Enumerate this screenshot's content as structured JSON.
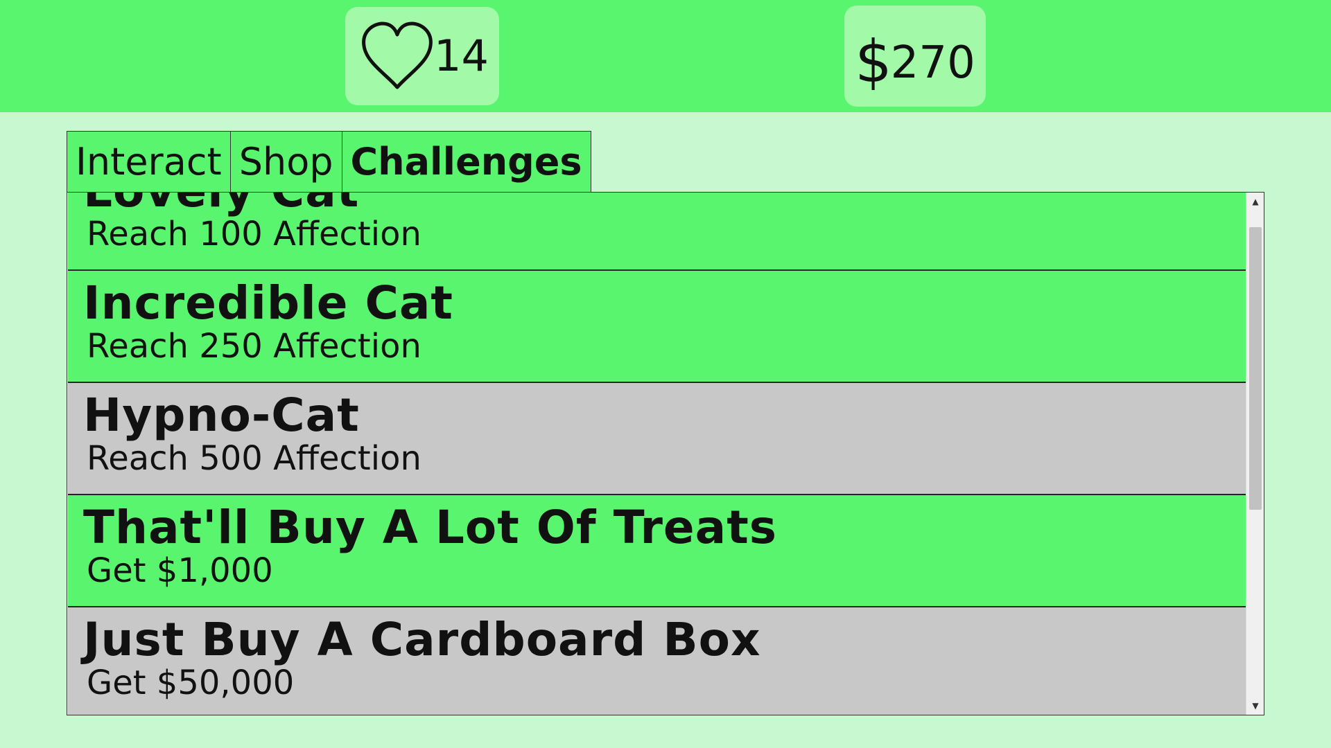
{
  "stats": {
    "affection": "14",
    "money": "270",
    "currency_symbol": "$"
  },
  "tabs": [
    {
      "label": "Interact",
      "active": false
    },
    {
      "label": "Shop",
      "active": false
    },
    {
      "label": "Challenges",
      "active": true
    }
  ],
  "challenges": [
    {
      "title": "Lovely Cat",
      "description": "Reach 100 Affection",
      "status": "complete"
    },
    {
      "title": "Incredible Cat",
      "description": "Reach 250 Affection",
      "status": "complete"
    },
    {
      "title": "Hypno-Cat",
      "description": "Reach 500 Affection",
      "status": "incomplete"
    },
    {
      "title": "That'll Buy A Lot Of Treats",
      "description": "Get $1,000",
      "status": "complete"
    },
    {
      "title": "Just Buy A Cardboard Box",
      "description": "Get $50,000",
      "status": "incomplete"
    }
  ],
  "colors": {
    "complete": "#5af56e",
    "incomplete": "#c8c8c8",
    "background": "#c8f8d0",
    "stat_box": "#a2f9a8"
  },
  "icons": {
    "affection": "heart-icon",
    "scroll_up": "triangle-up-icon",
    "scroll_down": "triangle-down-icon"
  }
}
